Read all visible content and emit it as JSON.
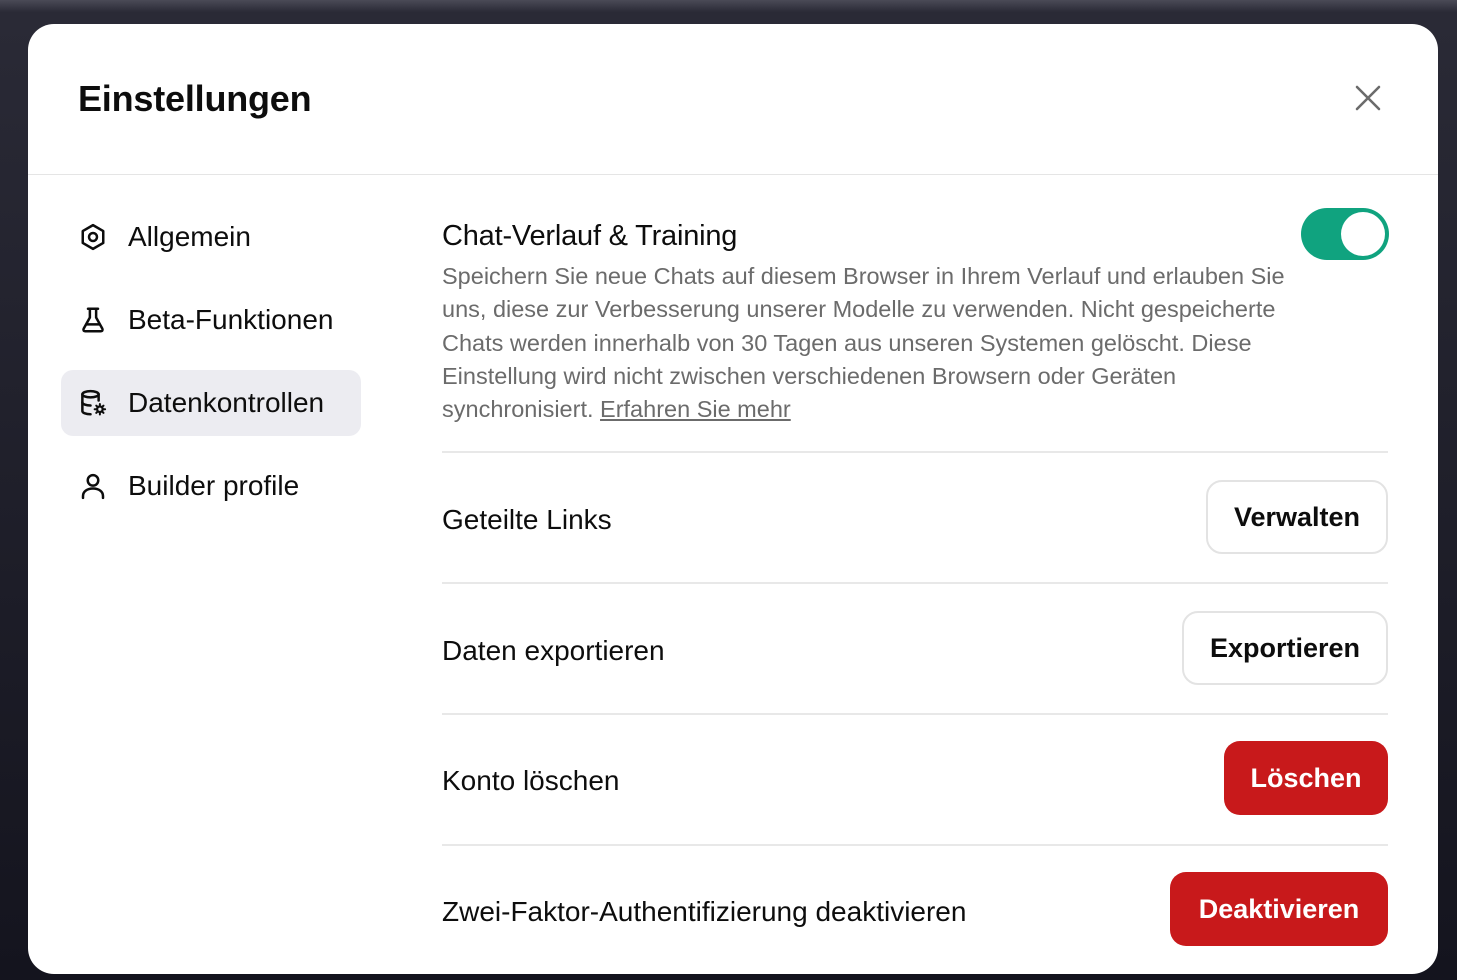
{
  "dialog": {
    "title": "Einstellungen",
    "close_icon": "close-icon"
  },
  "sidebar": {
    "items": [
      {
        "label": "Allgemein",
        "icon": "gear-icon",
        "active": false
      },
      {
        "label": "Beta-Funktionen",
        "icon": "flask-icon",
        "active": false
      },
      {
        "label": "Datenkontrollen",
        "icon": "database-settings-icon",
        "active": true
      },
      {
        "label": "Builder profile",
        "icon": "user-icon",
        "active": false
      }
    ]
  },
  "main": {
    "chat_history": {
      "title": "Chat-Verlauf & Training",
      "description": "Speichern Sie neue Chats auf diesem Browser in Ihrem Verlauf und erlauben Sie uns, diese zur Verbesserung unserer Modelle zu verwenden. Nicht gespeicherte Chats werden innerhalb von 30 Tagen aus unseren Systemen gelöscht. Diese Einstellung wird nicht zwischen verschiedenen Browsern oder Geräten synchronisiert.",
      "learn_more": "Erfahren Sie mehr",
      "toggle_on": true
    },
    "rows": [
      {
        "label": "Geteilte Links",
        "button": "Verwalten"
      },
      {
        "label": "Daten exportieren",
        "button": "Exportieren"
      },
      {
        "label": "Konto löschen",
        "button": "Löschen"
      },
      {
        "label": "Zwei-Faktor-Authentifizierung deaktivieren",
        "button": "Deaktivieren"
      }
    ]
  },
  "colors": {
    "accent_toggle": "#10a37f",
    "danger": "#c8191b",
    "active_nav_bg": "#ececf1"
  }
}
